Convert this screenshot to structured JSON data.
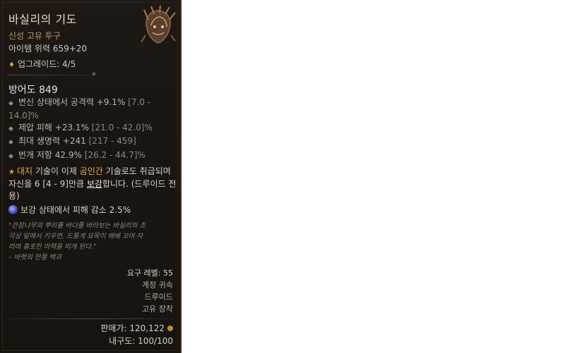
{
  "item": {
    "name": "바실리의 기도",
    "type": "신성 고유 투구",
    "power": "아이템 위력 659+20",
    "upgrade": "업그레이드: 4/5",
    "armor": "방어도 849",
    "affixes": [
      {
        "text": "변신 상태에서 공격력 +9.1%",
        "range": "[7.0 - 14.0]%"
      },
      {
        "text": "제압 피해 +23.1%",
        "range": "[21.0 - 42.0]%"
      },
      {
        "text": "최대 생명력 +241",
        "range": "[217 - 459]"
      },
      {
        "text": "번개 저항 42.9%",
        "range": "[26.2 - 44.7]%"
      }
    ],
    "legendary": {
      "p1": "대지",
      "p2": " 기술이 이제 ",
      "p3": "곰인간",
      "p4": " 기술로도 취급되며 자신을 6 [4 - 9]만큼 ",
      "p5": "보강",
      "p6": "합니다. (드루이드 전용)"
    },
    "aspect": "보강 상태에서 피해 감소 2.5%",
    "flavor": [
      "\"큰참나무의 뿌리를 바다를 바라보는 바실리의 조",
      "각상 밑에서 키우면, 드물게 묘목이 배배 꼬여 자",
      "라며 흉포한 마력을 띠게 된다.\"",
      "– 바렛의 만물 백과"
    ],
    "requirement_level": "요구 레벨: 55",
    "account_bound": "계정 귀속",
    "class": "드루이드",
    "unique_equip": "고유 장착",
    "sell_value": "판매가: 120,122",
    "durability": "내구도: 100/100"
  },
  "colors": {
    "background": "#1b1612",
    "title": "#e4d7c0",
    "type": "#b59a69",
    "legendary_highlight": "#e3b04b"
  },
  "icons": {
    "item_image": "helm-icon",
    "upgrade": "diamond-icon",
    "affix_bullet": "bullet-icon",
    "legendary": "star-icon",
    "aspect": "aspect-orb-icon",
    "gold": "gold-coin-icon"
  }
}
